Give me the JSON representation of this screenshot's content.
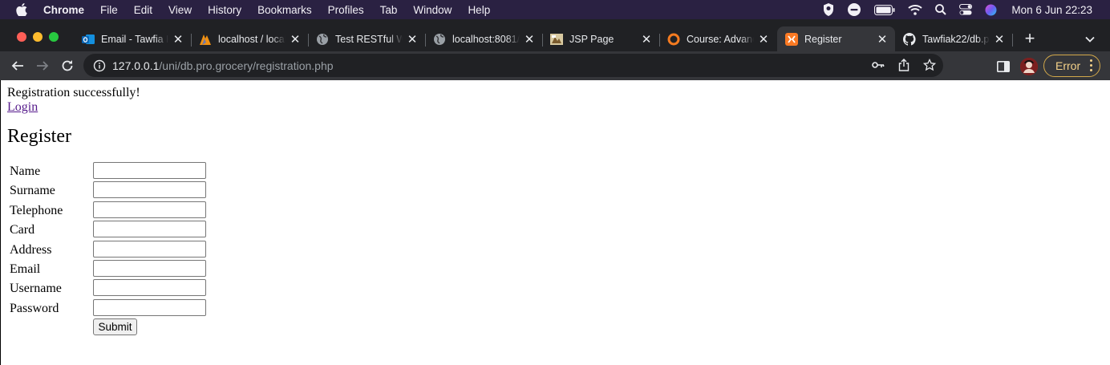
{
  "menubar": {
    "app": "Chrome",
    "items": [
      "File",
      "Edit",
      "View",
      "History",
      "Bookmarks",
      "Profiles",
      "Tab",
      "Window",
      "Help"
    ],
    "clock": "Mon 6 Jun  22:23"
  },
  "tabs": [
    {
      "title": "Email - Tawfia K",
      "icon": "outlook-icon"
    },
    {
      "title": "localhost / local",
      "icon": "phpmyadmin-icon"
    },
    {
      "title": "Test RESTful W",
      "icon": "globe-icon"
    },
    {
      "title": "localhost:8081/",
      "icon": "globe-icon"
    },
    {
      "title": "JSP Page",
      "icon": "jsp-icon"
    },
    {
      "title": "Course: Advanc",
      "icon": "moodle-icon"
    },
    {
      "title": "Register",
      "icon": "xampp-icon",
      "active": true
    },
    {
      "title": "Tawfiak22/db.p",
      "icon": "github-icon"
    }
  ],
  "omnibox": {
    "host": "127.0.0.1",
    "path": "/uni/db.pro.grocery/registration.php"
  },
  "toolbar": {
    "error_label": "Error"
  },
  "page": {
    "message": "Registration successfully!",
    "login_link": "Login",
    "heading": "Register",
    "fields": [
      "Name",
      "Surname",
      "Telephone",
      "Card",
      "Address",
      "Email",
      "Username",
      "Password"
    ],
    "submit_label": "Submit"
  }
}
